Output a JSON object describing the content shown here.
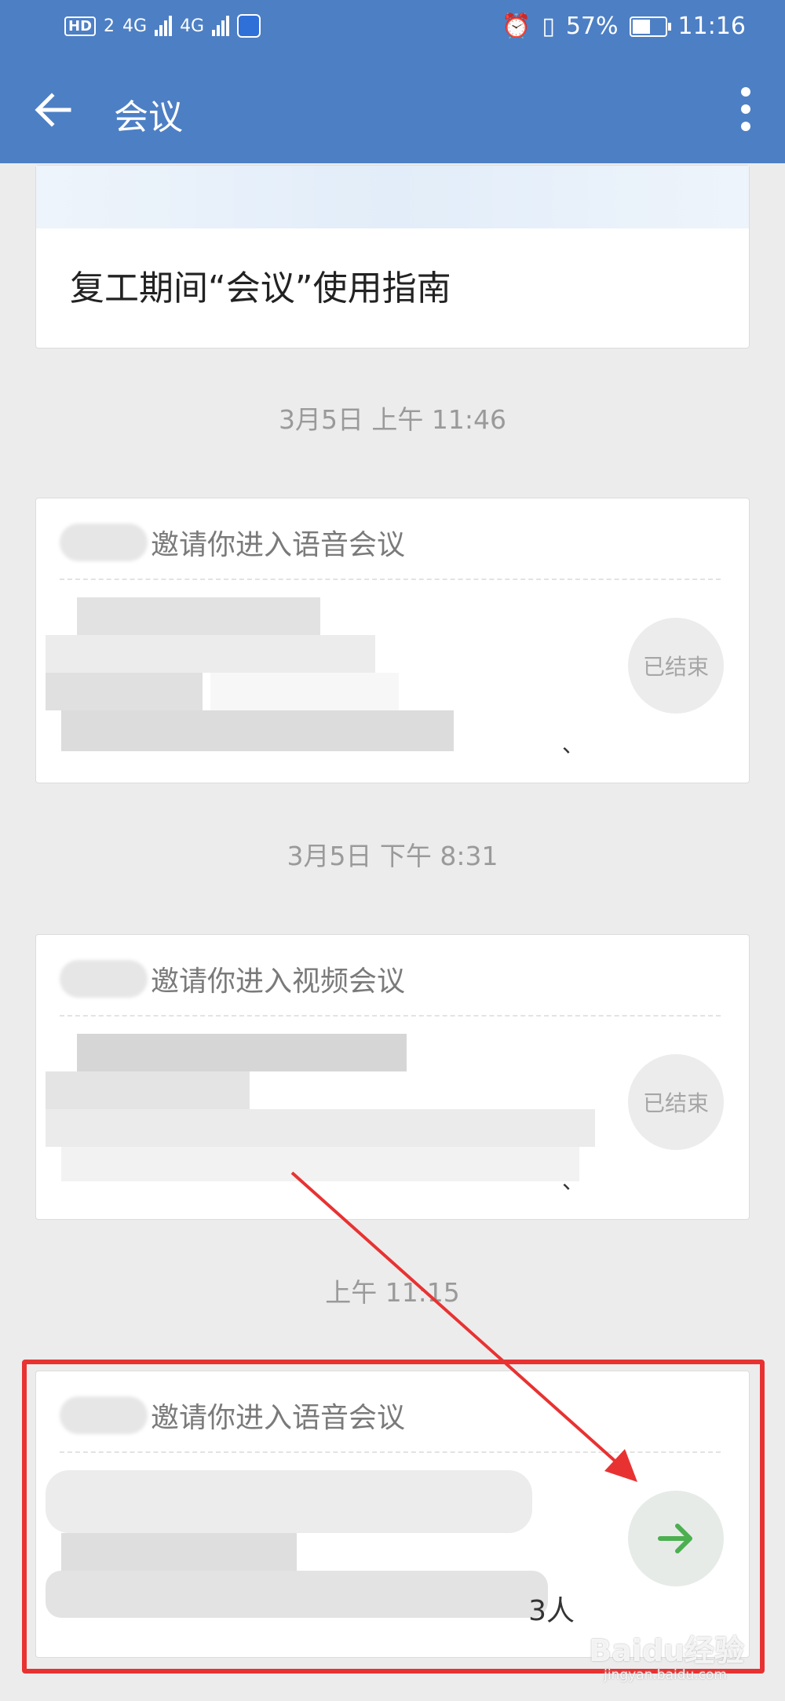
{
  "status_bar": {
    "hd_badge": "HD",
    "hd_sim": "2",
    "network1": "4G",
    "network2": "4G",
    "battery_percent": "57%",
    "time": "11:16"
  },
  "header": {
    "title": "会议"
  },
  "guide_card": {
    "title": "复工期间“会议”使用指南"
  },
  "meetings": [
    {
      "timestamp": "3月5日  上午 11:46",
      "invite_text": "邀请你进入语音会议",
      "status_label": "已结束",
      "trailing_text": "、"
    },
    {
      "timestamp": "3月5日  下午 8:31",
      "invite_text": "邀请你进入视频会议",
      "status_label": "已结束",
      "trailing_text": "、"
    },
    {
      "timestamp": "上午 11:15",
      "invite_text": "邀请你进入语音会议",
      "trailing_text": "3人",
      "join_icon": "arrow-right-icon"
    }
  ],
  "colors": {
    "header": "#4d7fc4",
    "highlight": "#e83232",
    "join_arrow": "#4caf50"
  },
  "watermark": {
    "text": "Baidu经验",
    "sub": "jingyan.baidu.com"
  }
}
